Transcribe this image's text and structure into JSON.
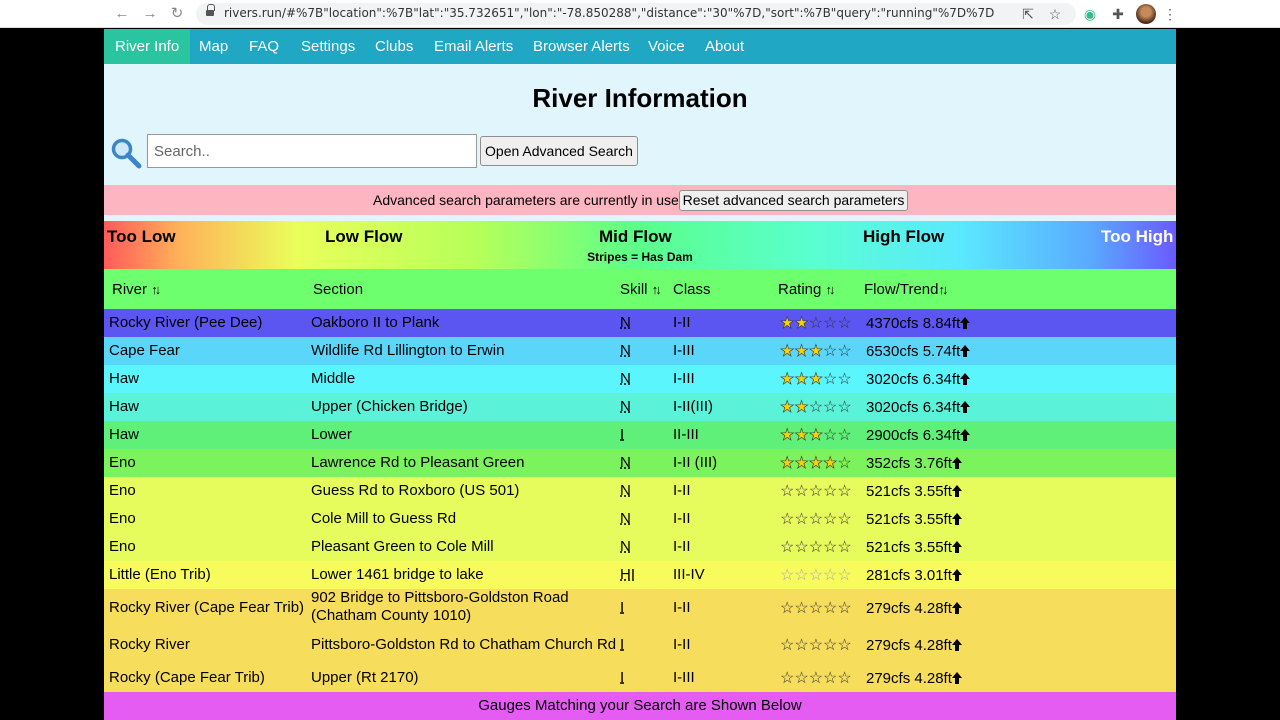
{
  "browser": {
    "url": "rivers.run/#%7B\"location\":%7B\"lat\":\"35.732651\",\"lon\":\"-78.850288\",\"distance\":\"30\"%7D,\"sort\":%7B\"query\":\"running\"%7D%7D"
  },
  "nav": {
    "items": [
      "River Info",
      "Map",
      "FAQ",
      "Settings",
      "Clubs",
      "Email Alerts",
      "Browser Alerts",
      "Voice",
      "About"
    ],
    "active": "River Info"
  },
  "page_title": "River Information",
  "search": {
    "placeholder": "Search..",
    "advanced_button": "Open Advanced Search"
  },
  "advanced_banner": {
    "text": "Advanced search parameters are currently in use.",
    "reset_button": "Reset advanced search parameters"
  },
  "legend": {
    "labels": [
      "Too Low",
      "Low Flow",
      "Mid Flow",
      "High Flow",
      "Too High"
    ],
    "note": "Stripes = Has Dam"
  },
  "table": {
    "headers": {
      "river": "River",
      "section": "Section",
      "skill": "Skill",
      "class": "Class",
      "rating": "Rating",
      "flow": "Flow/Trend"
    },
    "rows": [
      {
        "river": "Rocky River (Pee Dee)",
        "section": "Oakboro II to Plank",
        "skill": "N",
        "class": "I-II",
        "rating": 2,
        "flow": "4370cfs 8.84ft",
        "color": "#5b55f2"
      },
      {
        "river": "Cape Fear",
        "section": "Wildlife Rd Lillington to Erwin",
        "skill": "N",
        "class": "I-III",
        "rating": 3,
        "flow": "6530cfs 5.74ft",
        "color": "#5ad6fb"
      },
      {
        "river": "Haw",
        "section": "Middle",
        "skill": "N",
        "class": "I-III",
        "rating": 3,
        "flow": "3020cfs 6.34ft",
        "color": "#5af5fd"
      },
      {
        "river": "Haw",
        "section": "Upper (Chicken Bridge)",
        "skill": "N",
        "class": "I-II(III)",
        "rating": 2,
        "flow": "3020cfs 6.34ft",
        "color": "#5af2d8"
      },
      {
        "river": "Haw",
        "section": "Lower",
        "skill": "I",
        "class": "II-III",
        "rating": 3,
        "flow": "2900cfs 6.34ft",
        "color": "#5ef078"
      },
      {
        "river": "Eno",
        "section": "Lawrence Rd to Pleasant Green",
        "skill": "N",
        "class": "I-II (III)",
        "rating": 4,
        "flow": "352cfs 3.76ft",
        "color": "#7bf35c"
      },
      {
        "river": "Eno",
        "section": "Guess Rd to Roxboro (US 501)",
        "skill": "N",
        "class": "I-II",
        "rating": 0,
        "flow": "521cfs 3.55ft",
        "color": "#e6fb5c"
      },
      {
        "river": "Eno",
        "section": "Cole Mill to Guess Rd",
        "skill": "N",
        "class": "I-II",
        "rating": 0,
        "flow": "521cfs 3.55ft",
        "color": "#e6fb5c"
      },
      {
        "river": "Eno",
        "section": "Pleasant Green to Cole Mill",
        "skill": "N",
        "class": "I-II",
        "rating": 0,
        "flow": "521cfs 3.55ft",
        "color": "#e6fb5c"
      },
      {
        "river": "Little (Eno Trib)",
        "section": "Lower 1461 bridge to lake",
        "skill": "HI",
        "class": "III-IV",
        "rating": 0,
        "flow": "281cfs 3.01ft",
        "color": "#f8fb5c"
      },
      {
        "river": "Rocky River (Cape Fear Trib)",
        "section": "902 Bridge to Pittsboro-Goldston Road (Chatham County 1010)",
        "skill": "I",
        "class": "I-II",
        "rating": 0,
        "flow": "279cfs 4.28ft",
        "color": "#f7dd5c"
      },
      {
        "river": "Rocky River",
        "section": "Pittsboro-Goldston Rd to Chatham Church Rd",
        "skill": "I",
        "class": "I-II",
        "rating": 0,
        "flow": "279cfs 4.28ft",
        "color": "#f7dd5c"
      },
      {
        "river": "Rocky (Cape Fear Trib)",
        "section": "Upper (Rt 2170)",
        "skill": "I",
        "class": "I-III",
        "rating": 0,
        "flow": "279cfs 4.28ft",
        "color": "#f7dd5c"
      }
    ]
  },
  "gauges_bar": "Gauges Matching your Search are Shown Below",
  "colors": {
    "navbar": "#1fa7c3",
    "nav_active": "#2bc4a0",
    "header_row": "#6dff6e",
    "banner": "#fcb5c1",
    "gauges_bar": "#e45cf2"
  }
}
